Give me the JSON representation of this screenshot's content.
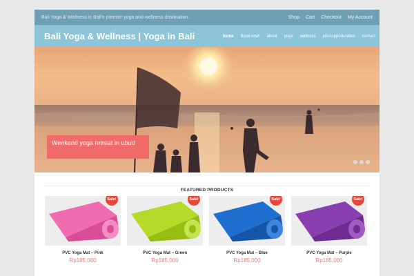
{
  "topbar": {
    "tagline": "Bali Yoga & Wellness is Bali's premier yoga and wellness destination.",
    "links": [
      "Shop",
      "Cart",
      "Checkout",
      "My Account"
    ]
  },
  "header": {
    "site_title": "Bali Yoga & Wellness | Yoga in Bali",
    "nav": [
      "home",
      "Book now!",
      "about",
      "yoga",
      "wellness",
      "jobs/opportunities",
      "contact"
    ]
  },
  "slider": {
    "caption": "Weekend yoga retreat in ubud",
    "slide_count": 3
  },
  "featured": {
    "heading": "FEATURED PRODUCTS",
    "products": [
      {
        "name": "PVC Yoga Mat – Pink",
        "price": "Rp185,000",
        "badge": "Sale!",
        "color": "#f06bb0"
      },
      {
        "name": "PVC Yoga Mat – Green",
        "price": "Rp185,000",
        "badge": "Sale!",
        "color": "#b6d92a"
      },
      {
        "name": "PVC Yoga Mat – Blue",
        "price": "Rp185,000",
        "badge": "Sale!",
        "color": "#1f6fd0"
      },
      {
        "name": "PVC Yoga Mat – Purple",
        "price": "Rp185,000",
        "badge": "Sale!",
        "color": "#8a3fb0"
      }
    ]
  },
  "colors": {
    "topbar": "#6e9fb3",
    "header": "#8cc4d8",
    "caption": "#f26b6b",
    "sale_badge": "#e5483a",
    "price": "#e57a7a"
  }
}
